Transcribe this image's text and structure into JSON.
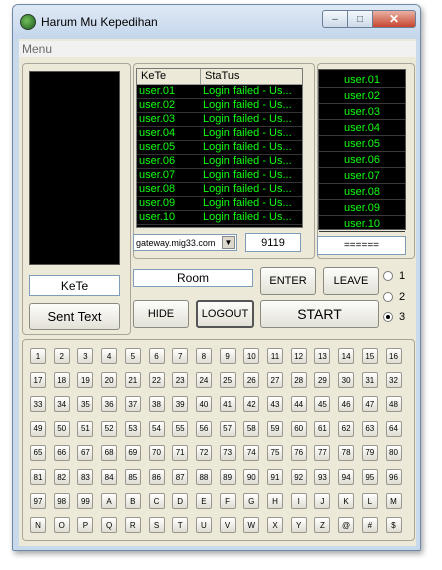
{
  "window": {
    "title": "Harum Mu Kepedihan"
  },
  "menubar": {
    "menu_label": "Menu"
  },
  "left_panel": {
    "kete_label": "KeTe",
    "sent_text_label": "Sent Text"
  },
  "status_grid": {
    "headers": [
      "KeTe",
      "StaTus"
    ],
    "rows": [
      [
        "user.01",
        "Login failed - Us..."
      ],
      [
        "user.02",
        "Login failed - Us..."
      ],
      [
        "user.03",
        "Login failed - Us..."
      ],
      [
        "user.04",
        "Login failed - Us..."
      ],
      [
        "user.05",
        "Login failed - Us..."
      ],
      [
        "user.06",
        "Login failed - Us..."
      ],
      [
        "user.07",
        "Login failed - Us..."
      ],
      [
        "user.08",
        "Login failed - Us..."
      ],
      [
        "user.09",
        "Login failed - Us..."
      ],
      [
        "user.10",
        "Login failed - Us..."
      ]
    ]
  },
  "server": {
    "host": "gateway.mig33.com",
    "port": "9119"
  },
  "user_list": {
    "items": [
      "user.01",
      "user.02",
      "user.03",
      "user.04",
      "user.05",
      "user.06",
      "user.07",
      "user.08",
      "user.09",
      "user.10"
    ],
    "footer": "======"
  },
  "controls": {
    "room_label": "Room",
    "enter_label": "ENTER",
    "leave_label": "LEAVE",
    "hide_label": "HIDE",
    "logout_label": "LOGOUT",
    "start_label": "START"
  },
  "radio_options": [
    "1",
    "2",
    "3"
  ],
  "radio_selected": "3",
  "keypad": {
    "keys": [
      "1",
      "2",
      "3",
      "4",
      "5",
      "6",
      "7",
      "8",
      "9",
      "10",
      "11",
      "12",
      "13",
      "14",
      "15",
      "16",
      "17",
      "18",
      "19",
      "20",
      "21",
      "22",
      "23",
      "24",
      "25",
      "26",
      "27",
      "28",
      "29",
      "30",
      "31",
      "32",
      "33",
      "34",
      "35",
      "36",
      "37",
      "38",
      "39",
      "40",
      "41",
      "42",
      "43",
      "44",
      "45",
      "46",
      "47",
      "48",
      "49",
      "50",
      "51",
      "52",
      "53",
      "54",
      "55",
      "56",
      "57",
      "58",
      "59",
      "60",
      "61",
      "62",
      "63",
      "64",
      "65",
      "66",
      "67",
      "68",
      "69",
      "70",
      "71",
      "72",
      "73",
      "74",
      "75",
      "76",
      "77",
      "78",
      "79",
      "80",
      "81",
      "82",
      "83",
      "84",
      "85",
      "86",
      "87",
      "88",
      "89",
      "90",
      "91",
      "92",
      "93",
      "94",
      "95",
      "96",
      "97",
      "98",
      "99",
      "A",
      "B",
      "C",
      "D",
      "E",
      "F",
      "G",
      "H",
      "I",
      "J",
      "K",
      "L",
      "M",
      "N",
      "O",
      "P",
      "Q",
      "R",
      "S",
      "T",
      "U",
      "V",
      "W",
      "X",
      "Y",
      "Z",
      "@",
      "#",
      "$"
    ]
  }
}
